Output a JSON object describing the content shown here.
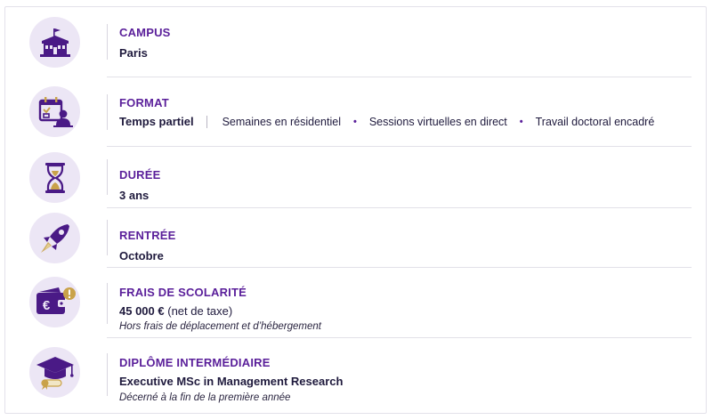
{
  "rows": {
    "campus": {
      "label": "CAMPUS",
      "value": "Paris",
      "icon": "university-building-icon"
    },
    "format": {
      "label": "FORMAT",
      "value": "Temps partiel",
      "options": [
        "Semaines en résidentiel",
        "Sessions virtuelles en direct",
        "Travail doctoral encadré"
      ],
      "icon": "calendar-user-icon"
    },
    "duree": {
      "label": "DURÉE",
      "value": "3 ans",
      "icon": "hourglass-icon"
    },
    "rentree": {
      "label": "RENTRÉE",
      "value": "Octobre",
      "icon": "rocket-icon"
    },
    "frais": {
      "label": "FRAIS DE SCOLARITÉ",
      "value": "45 000 €",
      "value_suffix": "(net de taxe)",
      "note": "Hors frais de déplacement et d’hébergement",
      "icon": "wallet-euro-icon"
    },
    "diplome": {
      "label": "DIPLÔME INTERMÉDIAIRE",
      "value": "Executive MSc in Management Research",
      "note": "Décerné à la fin de la première année",
      "icon": "graduation-cap-icon"
    }
  },
  "colors": {
    "accent": "#5a1f9a",
    "icon_bg": "#ece6f5",
    "text": "#1f1a3d",
    "badge": "#c9a24a"
  }
}
